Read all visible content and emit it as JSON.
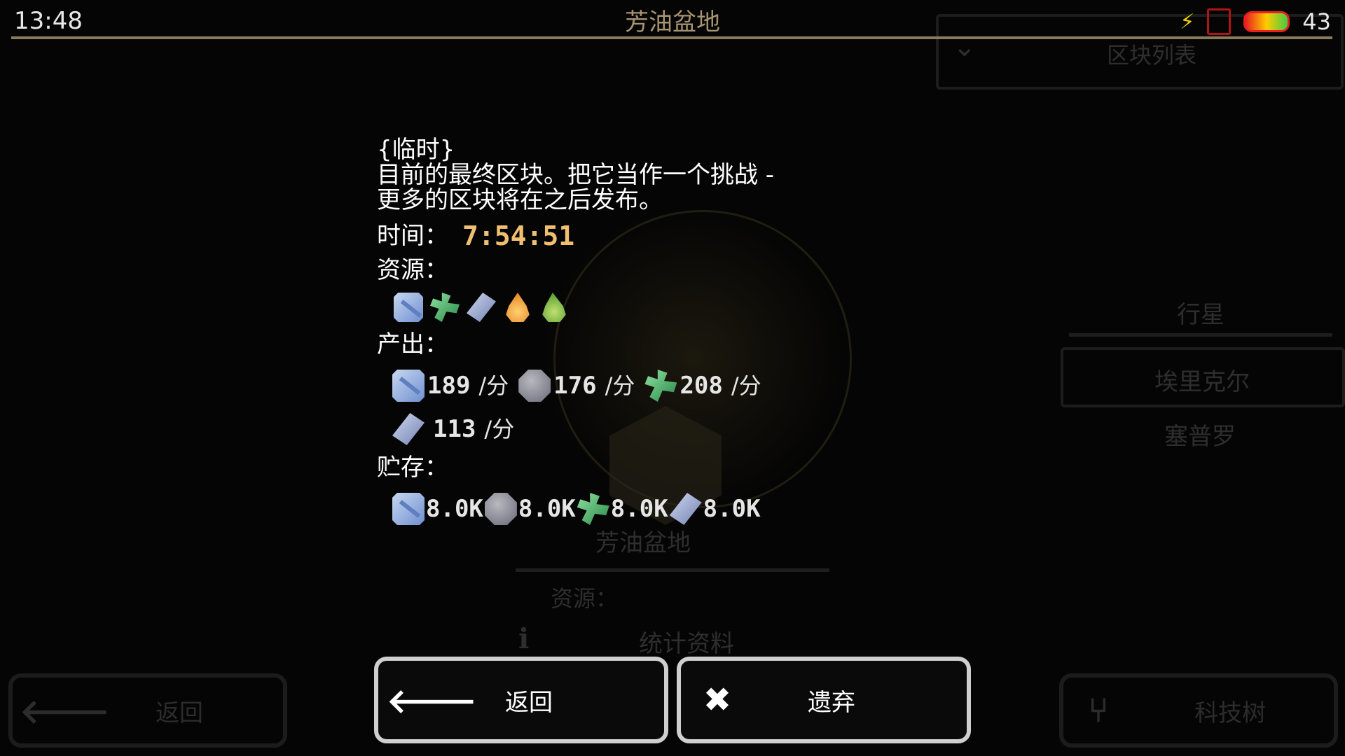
{
  "status_bar": {
    "time": "13:48",
    "battery": "43"
  },
  "header": {
    "title": "芳油盆地"
  },
  "background": {
    "sector_list": "区块列表",
    "tab_planet": "行星",
    "planet_selected": "埃里克尔",
    "planet_other": "塞普罗",
    "sector_name": "芳油盆地",
    "resources_label": "资源：",
    "stats_label": "统计资料",
    "back_label": "返回",
    "tech_tree_label": "科技树"
  },
  "dialog": {
    "note_line1": "{临时}",
    "note_line2": "目前的最终区块。把它当作一个挑战 -",
    "note_line3": "更多的区块将在之后发布。",
    "time_label": "时间：",
    "time_value": "7:54:51",
    "resources_label": "资源：",
    "resources": [
      "sand-icon",
      "scrap-icon",
      "metal-icon",
      "oil-icon",
      "spore-icon"
    ],
    "production_label": "产出：",
    "production": [
      {
        "icon": "sand-icon",
        "value": "189",
        "unit": "/分"
      },
      {
        "icon": "stone-icon",
        "value": "176",
        "unit": "/分"
      },
      {
        "icon": "scrap-icon",
        "value": "208",
        "unit": "/分"
      },
      {
        "icon": "metal-icon",
        "value": "113",
        "unit": "/分"
      }
    ],
    "storage_label": "贮存：",
    "storage": [
      {
        "icon": "sand-icon",
        "value": "8.0K"
      },
      {
        "icon": "stone-icon",
        "value": "8.0K"
      },
      {
        "icon": "scrap-icon",
        "value": "8.0K"
      },
      {
        "icon": "metal-icon",
        "value": "8.0K"
      }
    ]
  },
  "buttons": {
    "back": "返回",
    "abandon": "遗弃"
  }
}
